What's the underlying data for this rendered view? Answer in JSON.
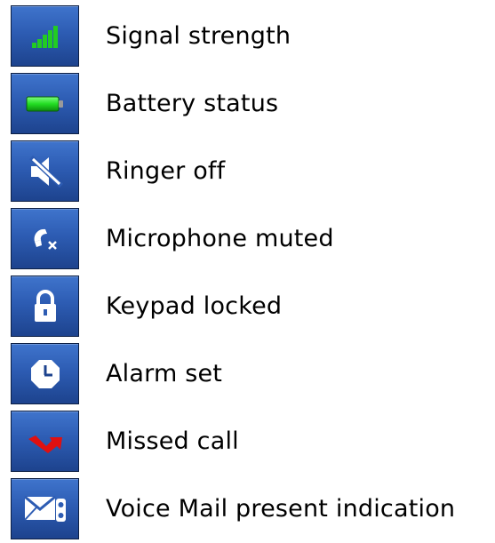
{
  "legend": {
    "items": [
      {
        "label": "Signal strength",
        "icon": "signal-strength-icon"
      },
      {
        "label": "Battery status",
        "icon": "battery-icon"
      },
      {
        "label": "Ringer off",
        "icon": "ringer-off-icon"
      },
      {
        "label": "Microphone muted",
        "icon": "microphone-muted-icon"
      },
      {
        "label": "Keypad locked",
        "icon": "padlock-icon"
      },
      {
        "label": "Alarm set",
        "icon": "alarm-clock-icon"
      },
      {
        "label": "Missed call",
        "icon": "missed-call-icon"
      },
      {
        "label": "Voice Mail present indication",
        "icon": "voice-mail-icon"
      }
    ]
  },
  "colors": {
    "tile_blue": "#2d5cb3",
    "signal_green": "#22cc22",
    "battery_green": "#22dd22",
    "missed_red": "#e01010"
  }
}
